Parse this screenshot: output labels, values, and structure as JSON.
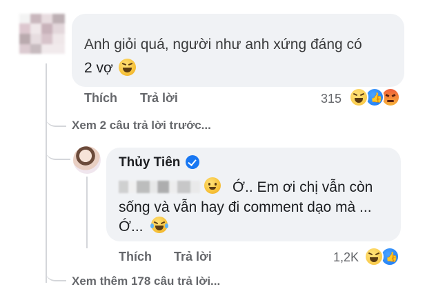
{
  "comment1": {
    "text_line1": "Anh giỏi quá, người như anh xứng đáng có",
    "text_line2": "2 vợ",
    "actions": {
      "like": "Thích",
      "reply": "Trả lời"
    },
    "reaction_count": "315",
    "reactions": [
      "haha-icon",
      "like-icon",
      "angry-icon"
    ]
  },
  "previous_replies": "Xem 2 câu trả lời trước...",
  "reply": {
    "author": "Thủy Tiên",
    "verified": true,
    "text_line1": "Ớ.. Em ơi chị vẫn còn",
    "text_line2": "sống và vẫn hay đi comment dạo mà ...",
    "text_line3": "Ớ...",
    "actions": {
      "like": "Thích",
      "reply": "Trả lời"
    },
    "reaction_count": "1,2K",
    "reactions": [
      "haha-icon",
      "like-icon"
    ]
  },
  "more_replies": "Xem thêm 178 câu trả lời...",
  "colors": {
    "bubble": "#f0f2f5",
    "meta_text": "#65676b",
    "like_blue": "#1877f2"
  }
}
